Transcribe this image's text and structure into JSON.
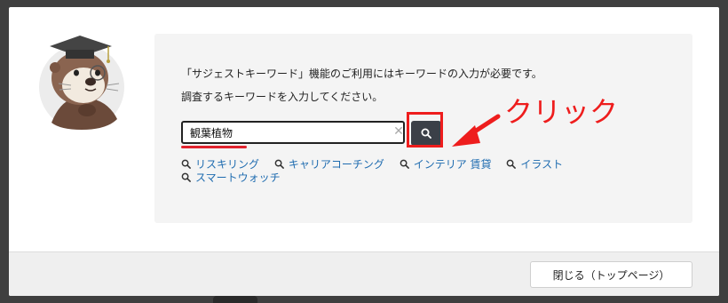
{
  "modal": {
    "message_line1": "「サジェストキーワード」機能のご利用にはキーワードの入力が必要です。",
    "message_line2": "調査するキーワードを入力してください。"
  },
  "search": {
    "value": "観葉植物",
    "clear_icon": "clear-x-icon",
    "button_icon": "search-icon"
  },
  "suggestions": [
    {
      "label": "リスキリング",
      "icon": "search-icon"
    },
    {
      "label": "キャリアコーチング",
      "icon": "search-icon"
    },
    {
      "label": "インテリア 賃貸",
      "icon": "search-icon"
    },
    {
      "label": "イラスト",
      "icon": "search-icon"
    },
    {
      "label": "スマートウォッチ",
      "icon": "search-icon"
    }
  ],
  "annotation": {
    "label": "クリック",
    "color": "#ee1d1d"
  },
  "footer": {
    "close_label": "閉じる（トップページ）"
  },
  "colors": {
    "link": "#1f6cb0",
    "search_button": "#3b4048",
    "panel_bg": "#f4f4f4"
  }
}
